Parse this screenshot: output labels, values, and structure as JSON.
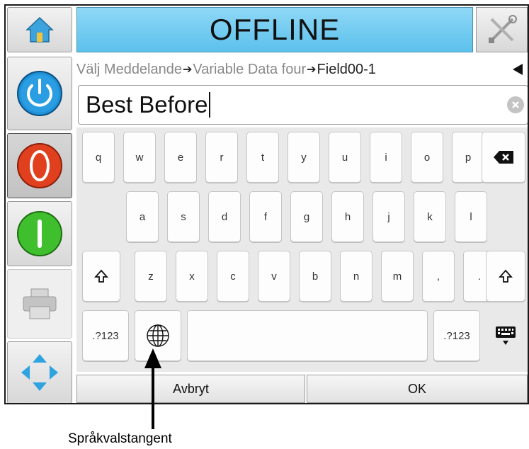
{
  "status": "OFFLINE",
  "breadcrumb": {
    "item1": "Välj Meddelande",
    "item2": "Variable Data four",
    "current": "Field00-1"
  },
  "text_field": {
    "value": "Best Before"
  },
  "keyboard": {
    "row1": [
      "q",
      "w",
      "e",
      "r",
      "t",
      "y",
      "u",
      "i",
      "o",
      "p"
    ],
    "row2": [
      "a",
      "s",
      "d",
      "f",
      "g",
      "h",
      "j",
      "k",
      "l"
    ],
    "row3": [
      "z",
      "x",
      "c",
      "v",
      "b",
      "n",
      "m",
      ",",
      "."
    ],
    "symbols_left": ".?123",
    "symbols_right": ".?123"
  },
  "buttons": {
    "cancel": "Avbryt",
    "ok": "OK"
  },
  "annotation": {
    "label": "Språkvalstangent"
  },
  "icons": {
    "home": "home-icon",
    "power": "power-icon",
    "stop": "stop-icon",
    "start": "start-icon",
    "printer": "printer-icon",
    "navigate": "navigation-arrows-icon",
    "tools": "tools-icon",
    "back": "back-arrow-icon",
    "clear": "clear-icon",
    "backspace": "backspace-icon",
    "shift": "shift-icon",
    "globe": "globe-icon",
    "keyboard_hide": "keyboard-hide-icon"
  },
  "colors": {
    "status_bar": "#5cc1ec",
    "power": "#1f8fd6",
    "stop": "#e0401e",
    "start": "#3fbf2e",
    "navigate": "#2ea3e0"
  }
}
